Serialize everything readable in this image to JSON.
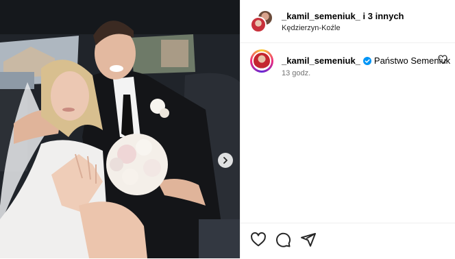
{
  "header": {
    "username": "_kamil_semeniuk_",
    "joiner": " i ",
    "others": "3 innych",
    "location": "Kędzierzyn-Koźle"
  },
  "post": {
    "username": "_kamil_semeniuk_",
    "caption": "Państwo Semeniuk",
    "time": "13 godz."
  },
  "icons": {
    "verified": "verified-badge-icon",
    "like": "heart-icon",
    "comment": "comment-icon",
    "share": "share-icon",
    "next": "chevron-right-icon"
  },
  "colors": {
    "verified": "#0095f6",
    "muted": "#737373",
    "divider": "#efefef"
  }
}
